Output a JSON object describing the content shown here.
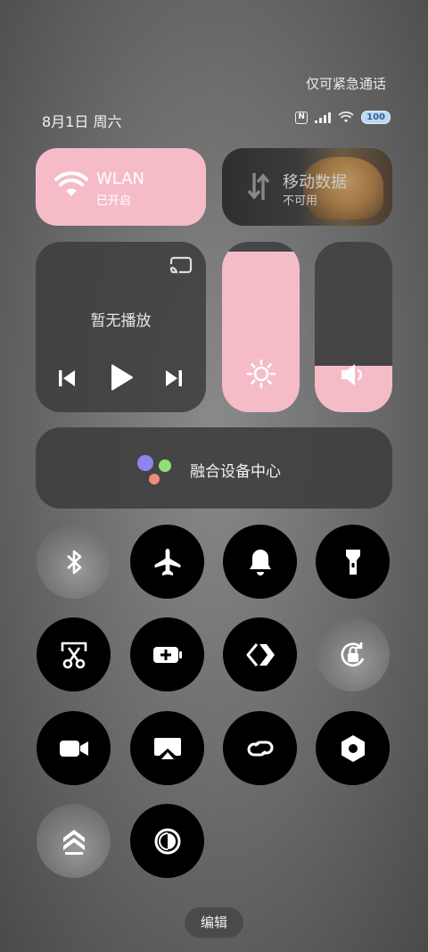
{
  "header": {
    "emergency_text": "仅可紧急通话",
    "date_text": "8月1日 周六",
    "battery_level": "100"
  },
  "tiles": {
    "wlan": {
      "title": "WLAN",
      "status": "已开启"
    },
    "mobile_data": {
      "title": "移动数据",
      "status": "不可用"
    },
    "media": {
      "status": "暂无播放"
    },
    "brightness": {
      "level": 0.94
    },
    "volume": {
      "level": 0.27
    },
    "device_hub": {
      "label": "融合设备中心"
    }
  },
  "toggles": [
    {
      "name": "bluetooth",
      "icon": "bluetooth-icon",
      "active": false
    },
    {
      "name": "airplane-mode",
      "icon": "airplane-icon",
      "active": true
    },
    {
      "name": "sound",
      "icon": "bell-icon",
      "active": true
    },
    {
      "name": "flashlight",
      "icon": "flashlight-icon",
      "active": true
    },
    {
      "name": "screenshot",
      "icon": "scissors-icon",
      "active": true
    },
    {
      "name": "battery-saver",
      "icon": "battery-plus-icon",
      "active": true
    },
    {
      "name": "cast",
      "icon": "cast-arrow-icon",
      "active": true
    },
    {
      "name": "rotation-lock",
      "icon": "rotation-lock-icon",
      "active": false
    },
    {
      "name": "screen-record",
      "icon": "video-camera-icon",
      "active": true
    },
    {
      "name": "screen-mirror",
      "icon": "airplay-icon",
      "active": true
    },
    {
      "name": "link-share",
      "icon": "link-icon",
      "active": true
    },
    {
      "name": "settings",
      "icon": "hexagon-icon",
      "active": true
    },
    {
      "name": "performance",
      "icon": "chevrons-up-icon",
      "active": false
    },
    {
      "name": "dark-mode",
      "icon": "contrast-icon",
      "active": true
    }
  ],
  "footer": {
    "edit_label": "编辑"
  },
  "colors": {
    "accent_pink": "#f5bcc8",
    "tile_dark": "#3e3e3e"
  }
}
